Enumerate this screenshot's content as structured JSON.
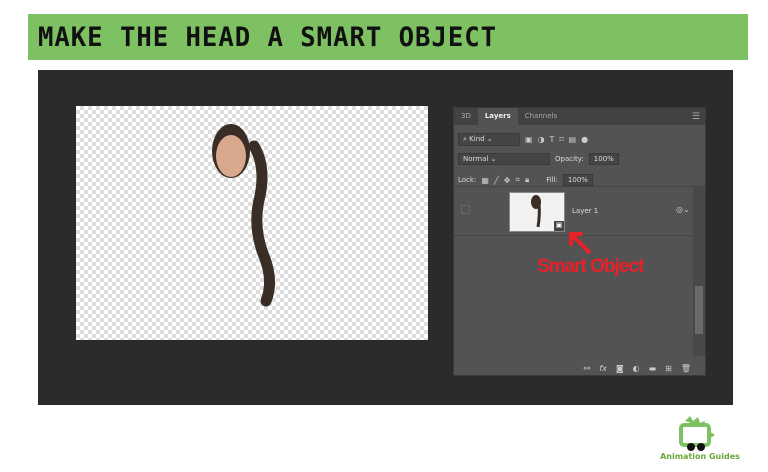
{
  "banner": {
    "title": "MAKE THE HEAD A SMART OBJECT",
    "color": "#7dc163"
  },
  "layers_panel": {
    "tabs": [
      {
        "label": "3D"
      },
      {
        "label": "Layers",
        "active": true
      },
      {
        "label": "Channels"
      }
    ],
    "filter": {
      "label": "Kind"
    },
    "blend_mode": "Normal",
    "opacity": {
      "label": "Opacity:",
      "value": "100%"
    },
    "lock_label": "Lock:",
    "fill": {
      "label": "Fill:",
      "value": "100%"
    },
    "layers": [
      {
        "name": "Layer 1",
        "type": "smart-object"
      }
    ],
    "footer_icons": [
      "link-icon",
      "fx-icon",
      "mask-icon",
      "adjustment-icon",
      "folder-icon",
      "new-layer-icon",
      "trash-icon"
    ]
  },
  "annotation": {
    "text": "Smart Object",
    "color": "#e8202a"
  },
  "logo": {
    "text": "Animation Guides"
  }
}
